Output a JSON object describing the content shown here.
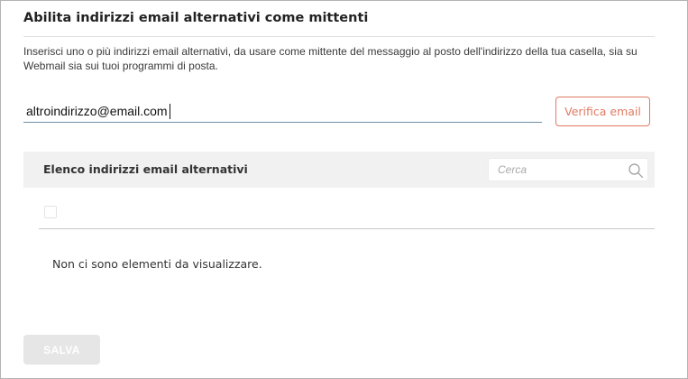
{
  "section": {
    "title": "Abilita indirizzi email alternativi come mittenti",
    "description": "Inserisci uno o più indirizzi email alternativi, da usare come mittente del messaggio al posto dell'indirizzo della tua casella, sia su Webmail sia sui tuoi programmi di posta."
  },
  "email_form": {
    "value": "altroindirizzo@email.com",
    "verify_label": "Verifica email"
  },
  "list": {
    "title": "Elenco indirizzi email alternativi",
    "search_placeholder": "Cerca",
    "search_icon": "search-icon",
    "empty_message": "Non ci sono elementi da visualizzare."
  },
  "footer": {
    "save_label": "SALVA"
  },
  "colors": {
    "accent": "#e07a62",
    "input_underline": "#6d8fa6",
    "header_bg": "#f1f1f1",
    "disabled_button": "#e6e6e6"
  }
}
